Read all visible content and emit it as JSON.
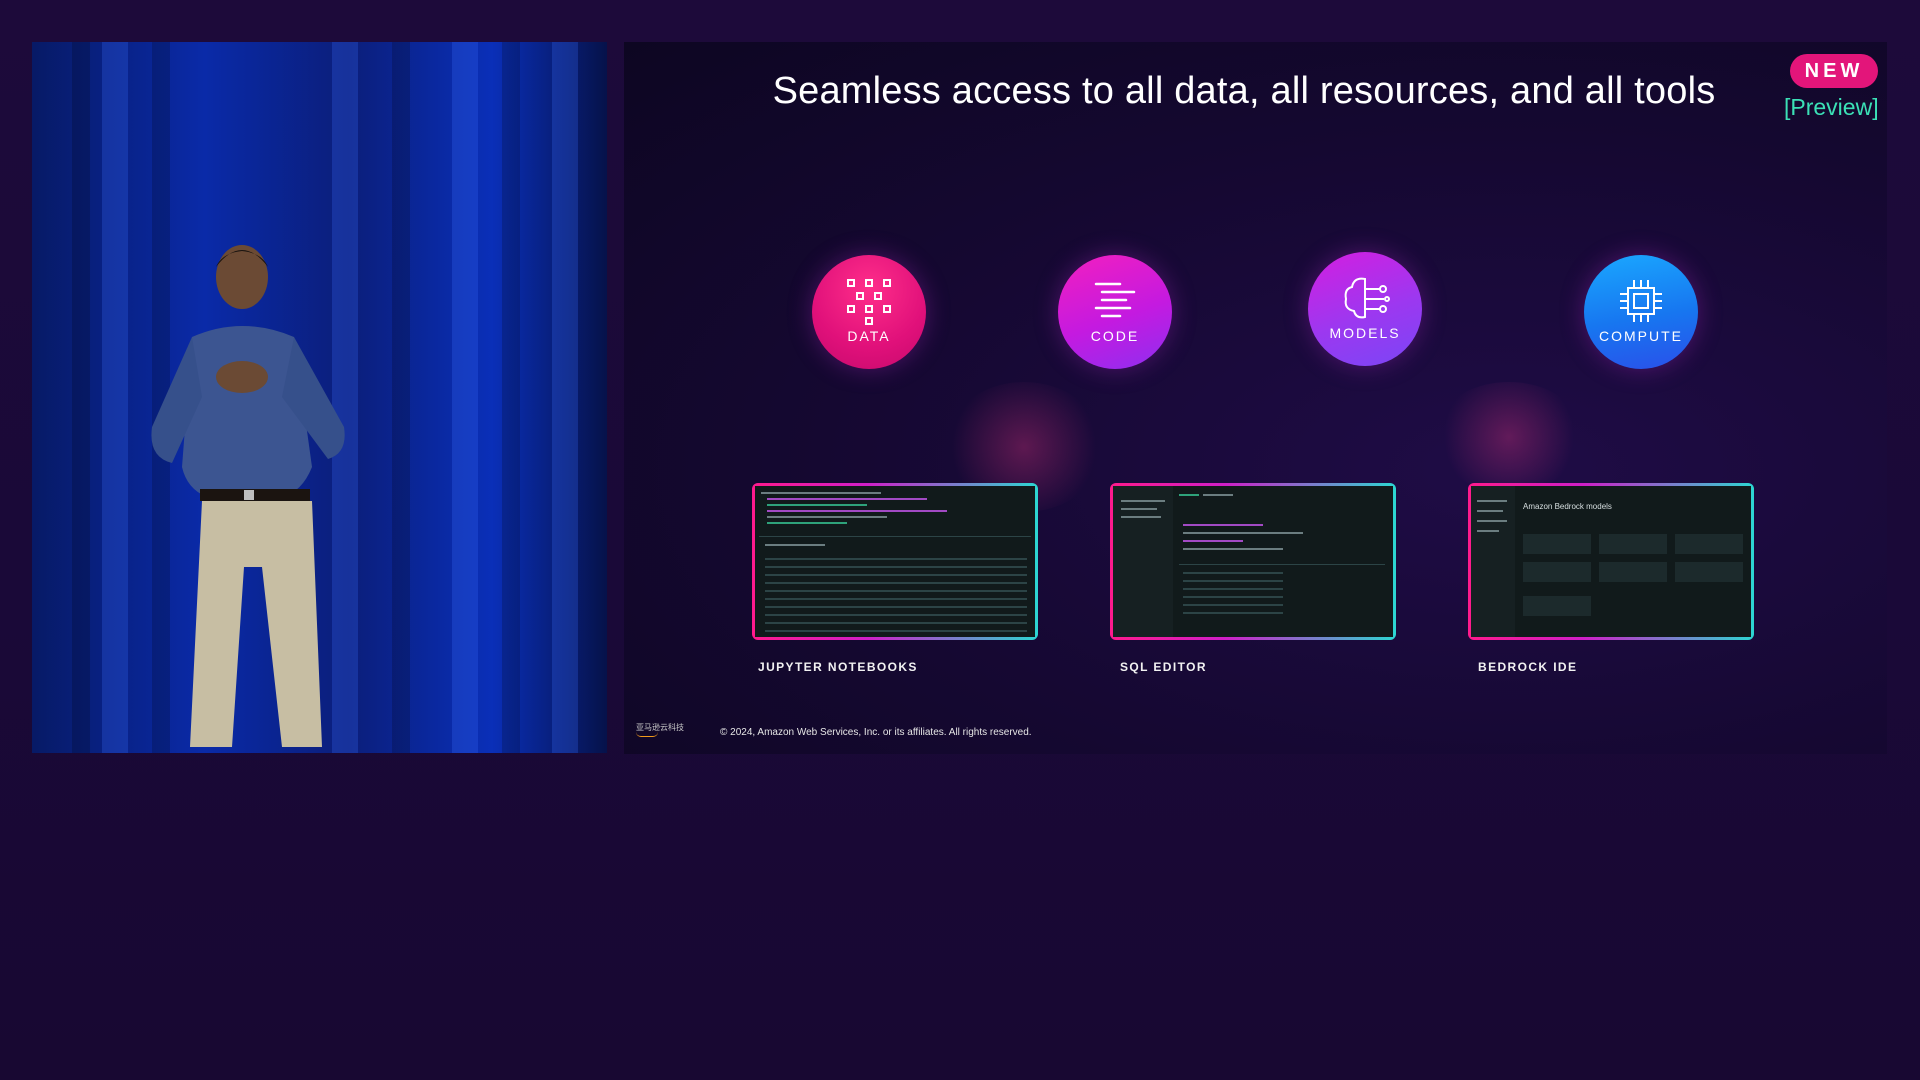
{
  "slide": {
    "title": "Seamless access to all data, all resources, and all tools",
    "badge": "NEW",
    "preview": "[Preview]",
    "pillars": [
      {
        "label": "DATA",
        "icon": "data-grid-icon"
      },
      {
        "label": "CODE",
        "icon": "code-lines-icon"
      },
      {
        "label": "MODELS",
        "icon": "brain-circuit-icon"
      },
      {
        "label": "COMPUTE",
        "icon": "chip-icon"
      }
    ],
    "tools": [
      {
        "label": "JUPYTER NOTEBOOKS"
      },
      {
        "label": "SQL EDITOR"
      },
      {
        "label": "BEDROCK IDE",
        "screen_title": "Amazon Bedrock models"
      }
    ],
    "footer_logo": "亚马逊云科技",
    "copyright": "© 2024, Amazon Web Services, Inc. or its affiliates. All rights reserved."
  },
  "colors": {
    "background": "#1b0a38",
    "badge": "#e3157a",
    "preview": "#3be0b6",
    "curtain": "#0a2aa8",
    "data": "#e0107a",
    "code": "#c41ae0",
    "models": "#9c38f0",
    "compute": "#1776f0"
  }
}
